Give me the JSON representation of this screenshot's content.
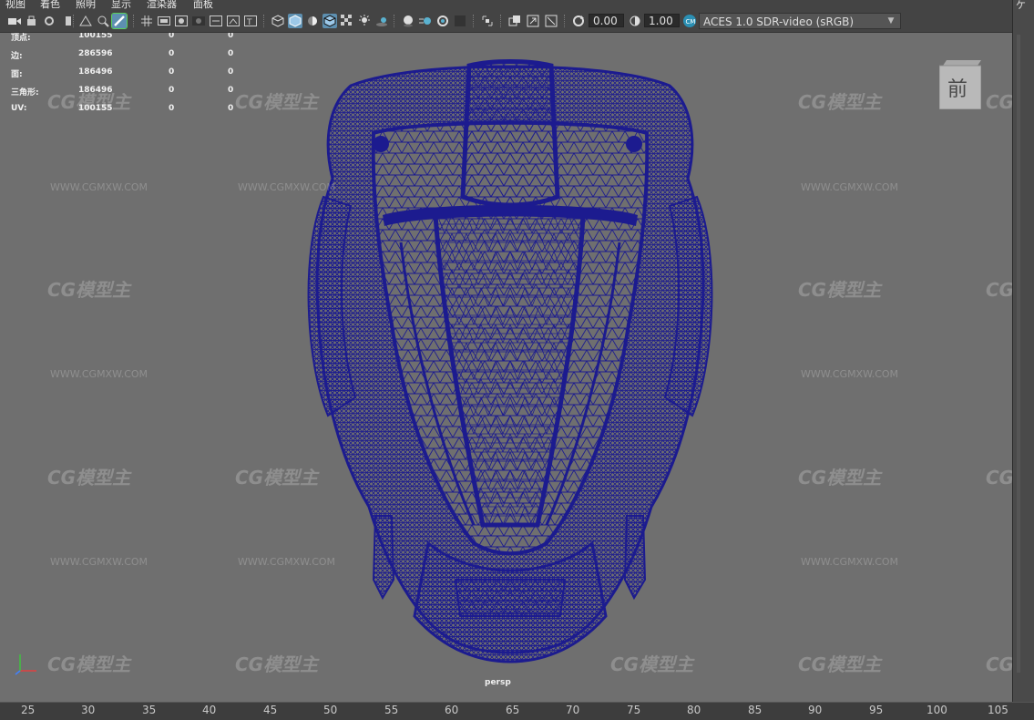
{
  "menu": [
    {
      "id": "view",
      "label": "视图"
    },
    {
      "id": "shading",
      "label": "着色"
    },
    {
      "id": "lighting",
      "label": "照明"
    },
    {
      "id": "show",
      "label": "显示"
    },
    {
      "id": "renderer",
      "label": "渲染器"
    },
    {
      "id": "panels",
      "label": "面板"
    }
  ],
  "toolbar": {
    "exposure_value": "0.00",
    "gamma_value": "1.00",
    "color_space": "ACES 1.0 SDR-video (sRGB)"
  },
  "hud": {
    "rows": [
      {
        "label": "顶点:",
        "total": "100155",
        "selected": "0",
        "comp": "0"
      },
      {
        "label": "边:",
        "total": "286596",
        "selected": "0",
        "comp": "0"
      },
      {
        "label": "面:",
        "total": "186496",
        "selected": "0",
        "comp": "0"
      },
      {
        "label": "三角形:",
        "total": "186496",
        "selected": "0",
        "comp": "0"
      },
      {
        "label": "UV:",
        "total": "100155",
        "selected": "0",
        "comp": "0"
      }
    ]
  },
  "viewcube_label": "前",
  "camera_label": "persp",
  "right_edge_text": "ケ",
  "watermark": {
    "logo": "CG模型主",
    "url": "WWW.CGMXW.COM"
  },
  "timeline_ticks": [
    "25",
    "30",
    "35",
    "40",
    "45",
    "50",
    "55",
    "60",
    "65",
    "70",
    "75",
    "80",
    "85",
    "90",
    "95",
    "100",
    "105"
  ],
  "colors": {
    "viewport_bg": "#6f6f6f",
    "wireframe": "#1c1b8f",
    "active_tool": "#5d8fb0"
  }
}
